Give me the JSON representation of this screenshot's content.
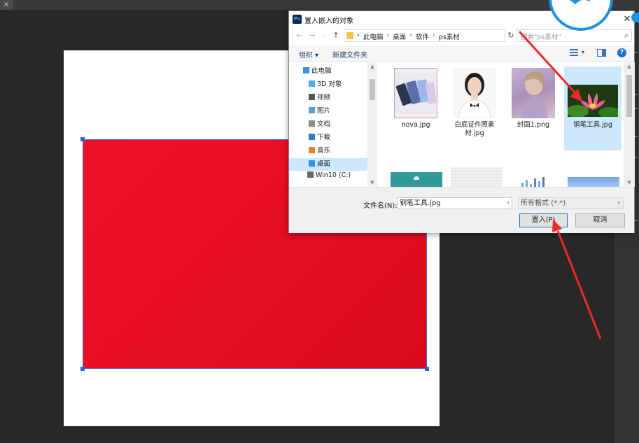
{
  "photoshop": {
    "tab_close_glyph": "×"
  },
  "dialog": {
    "app_icon_text": "Ps",
    "title": "置入嵌入的对象",
    "close_glyph": "✕",
    "address": {
      "crumbs": [
        "此电脑",
        "桌面",
        "软件",
        "ps素材"
      ],
      "separator": "›"
    },
    "search": {
      "placeholder": "搜索\"ps素材\""
    },
    "toolbar": {
      "organize": "组织 ▾",
      "new_folder": "新建文件夹"
    },
    "sidebar": {
      "items": [
        {
          "label": "此电脑",
          "icon": "computer-icon",
          "color": "#3b8ee8"
        },
        {
          "label": "3D 对象",
          "icon": "3d-objects-icon",
          "color": "#4ab0f0"
        },
        {
          "label": "视频",
          "icon": "video-icon",
          "color": "#555555"
        },
        {
          "label": "图片",
          "icon": "pictures-icon",
          "color": "#5aa0d8"
        },
        {
          "label": "文档",
          "icon": "documents-icon",
          "color": "#8a8a8a"
        },
        {
          "label": "下载",
          "icon": "downloads-icon",
          "color": "#2f7fd0"
        },
        {
          "label": "音乐",
          "icon": "music-icon",
          "color": "#e8842c"
        },
        {
          "label": "桌面",
          "icon": "desktop-icon",
          "color": "#3b8ee8"
        },
        {
          "label": "Win10 (C:)",
          "icon": "drive-icon",
          "color": "#6a6a6a"
        }
      ],
      "selected": "桌面"
    },
    "files": [
      {
        "name": "nova.jpg",
        "thumb": "phones-thumbnail"
      },
      {
        "name": "白底证件照素材.jpg",
        "thumb": "portrait-thumbnail"
      },
      {
        "name": "封面1.png",
        "thumb": "painting-thumbnail"
      },
      {
        "name": "钢笔工具.jpg",
        "thumb": "lotus-thumbnail"
      }
    ],
    "selected_file": "钢笔工具.jpg",
    "footer": {
      "filename_label": "文件名(N):",
      "filename_value": "钢笔工具.jpg",
      "filter_value": "所有格式 (*.*)",
      "place_button": "置入(P)",
      "cancel_button": "取消"
    }
  },
  "colors": {
    "layer_fill": "#e8102a",
    "selection": "#cce8ff",
    "annotation_arrow": "#ee2a2a",
    "accent": "#1d6fd8"
  }
}
